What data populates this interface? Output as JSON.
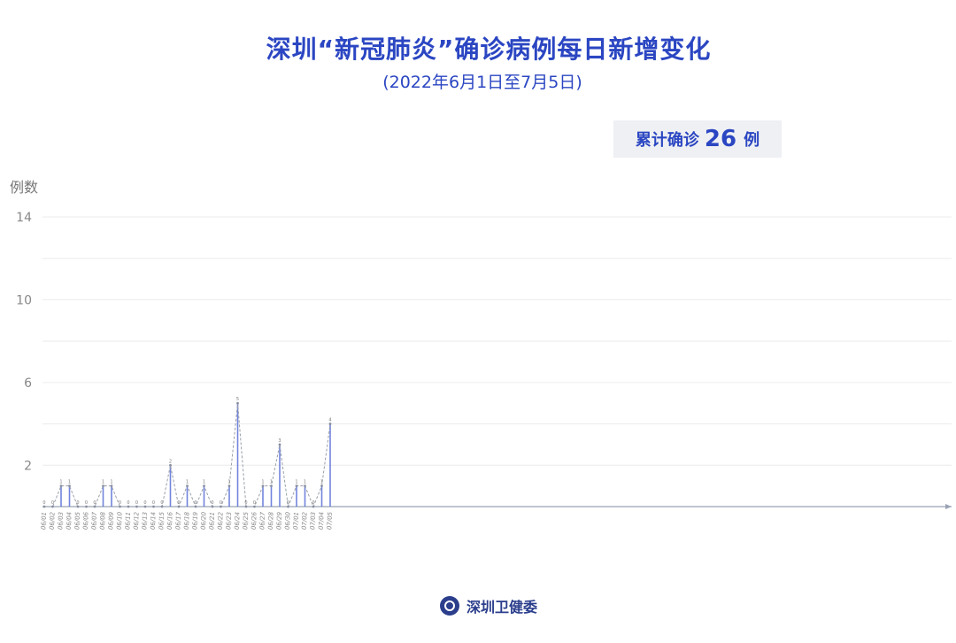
{
  "header": {
    "title": "深圳“新冠肺炎”确诊病例每日新增变化",
    "subtitle": "(2022年6月1日至7月5日)"
  },
  "total": {
    "label": "累计确诊",
    "value": "26",
    "unit": "例"
  },
  "footer": {
    "org_name": "深圳卫健委",
    "logo_icon": "health-commission-logo-icon"
  },
  "colors": {
    "accent": "#2b46c2",
    "line": "#9aa0aa",
    "bar": "#5a6fd6"
  },
  "chart_data": {
    "type": "line",
    "title": "深圳“新冠肺炎”确诊病例每日新增变化",
    "subtitle": "(2022年6月1日至7月5日)",
    "ylabel": "例数",
    "xlabel": "",
    "ylim": [
      0,
      14
    ],
    "yticks": [
      2,
      6,
      10,
      14
    ],
    "grid": true,
    "x": [
      "06/01",
      "06/02",
      "06/03",
      "06/04",
      "06/05",
      "06/06",
      "06/07",
      "06/08",
      "06/09",
      "06/10",
      "06/11",
      "06/12",
      "06/13",
      "06/14",
      "06/15",
      "06/16",
      "06/17",
      "06/18",
      "06/19",
      "06/20",
      "06/21",
      "06/22",
      "06/23",
      "06/24",
      "06/25",
      "06/26",
      "06/27",
      "06/28",
      "06/29",
      "06/30",
      "07/01",
      "07/02",
      "07/03",
      "07/04",
      "07/05"
    ],
    "values": [
      0,
      0,
      1,
      1,
      0,
      0,
      0,
      1,
      1,
      0,
      0,
      0,
      0,
      0,
      0,
      2,
      0,
      1,
      0,
      1,
      0,
      0,
      1,
      5,
      0,
      0,
      1,
      1,
      3,
      0,
      1,
      1,
      0,
      1,
      4
    ],
    "data_labels": [
      "0",
      "0",
      "1",
      "1",
      "0",
      "0",
      "0",
      "1",
      "1",
      "0",
      "0",
      "0",
      "0",
      "0",
      "0",
      "2",
      "0",
      "1",
      "0",
      "1",
      "0",
      "0",
      "1",
      "5",
      "0",
      "0",
      "1",
      "1",
      "3",
      "0",
      "1",
      "1",
      "0",
      "1",
      "4"
    ]
  }
}
